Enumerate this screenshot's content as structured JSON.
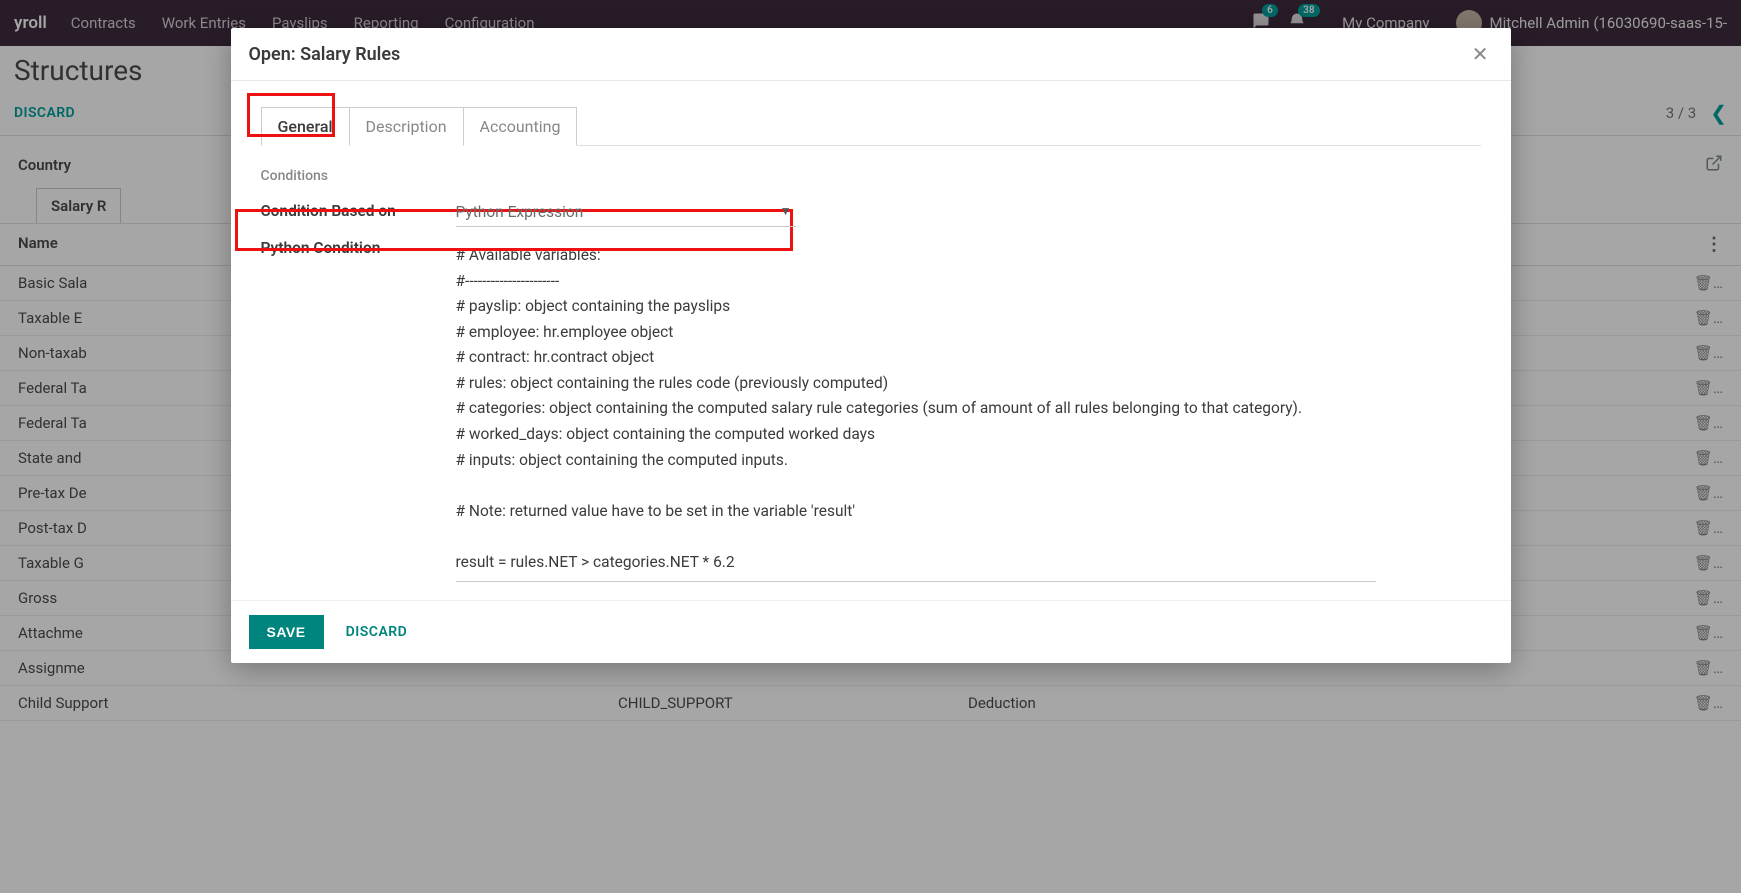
{
  "topbar": {
    "brand": "yroll",
    "nav": [
      "Contracts",
      "Work Entries",
      "Payslips",
      "Reporting",
      "Configuration"
    ],
    "badge_chat": "6",
    "badge_activity": "38",
    "company": "My Company",
    "user": "Mitchell Admin (16030690-saas-15-"
  },
  "subhead": {
    "title": "Structures"
  },
  "actionbar": {
    "discard": "DISCARD",
    "pagecount": "3 / 3"
  },
  "bg": {
    "country_label": "Country",
    "tab": "Salary R",
    "col_name": "Name",
    "rows": [
      "Basic Sala",
      "Taxable E",
      "Non-taxab",
      "Federal Ta",
      "Federal Ta",
      "State and",
      "Pre-tax De",
      "Post-tax D",
      "Taxable G",
      "Gross",
      "Attachme",
      "Assignme",
      "Child Support"
    ],
    "child_support_code": "CHILD_SUPPORT",
    "child_support_cat": "Deduction",
    "trash": "🗑…",
    "dots": "⋮"
  },
  "modal": {
    "title": "Open: Salary Rules",
    "tabs": {
      "general": "General",
      "description": "Description",
      "accounting": "Accounting"
    },
    "section_conditions": "Conditions",
    "field_condition_based": "Condition Based on",
    "value_condition_based": "Python Expression",
    "field_python_condition": "Python Condition",
    "python_body": "# Available variables:\n#----------------------\n# payslip: object containing the payslips\n# employee: hr.employee object\n# contract: hr.contract object\n# rules: object containing the rules code (previously computed)\n# categories: object containing the computed salary rule categories (sum of amount of all rules belonging to that category).\n# worked_days: object containing the computed worked days\n# inputs: object containing the computed inputs.\n\n# Note: returned value have to be set in the variable 'result'",
    "result_line": "result = rules.NET > categories.NET * 6.2",
    "save": "SAVE",
    "discard": "DISCARD"
  }
}
